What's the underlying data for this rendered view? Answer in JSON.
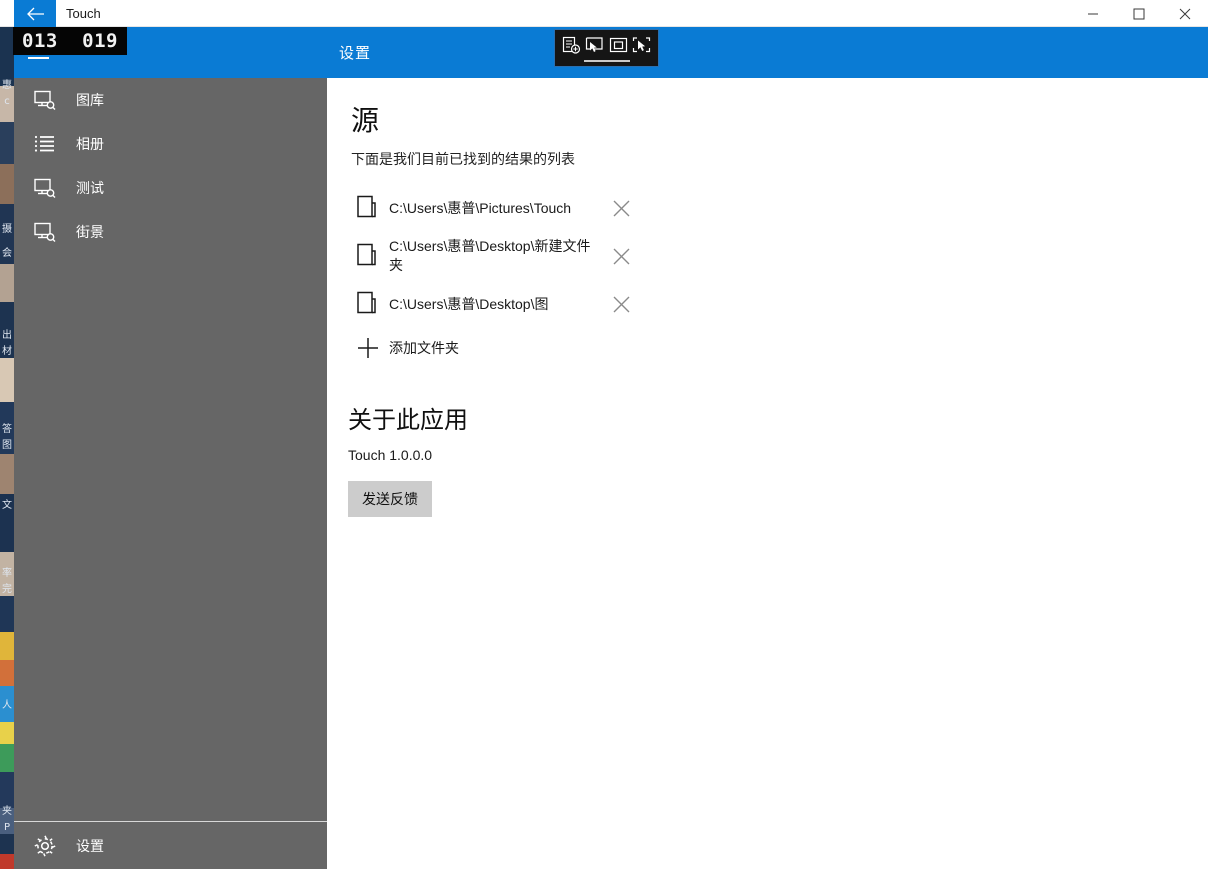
{
  "window": {
    "title": "Touch",
    "back_icon": "back-arrow-icon",
    "minimize_label": "—",
    "maximize_label": "□",
    "close_label": "✕"
  },
  "header": {
    "menu_icon": "hamburger-menu-icon",
    "title": "设置"
  },
  "coord_overlay": {
    "x_value": "013",
    "y_value": "019"
  },
  "capture_toolbar": {
    "icons": [
      "new-snip-icon",
      "rectangular-snip-icon",
      "window-snip-icon",
      "freeform-snip-icon"
    ]
  },
  "sidebar": {
    "items": [
      {
        "label": "图库",
        "icon": "photo-search-icon"
      },
      {
        "label": "相册",
        "icon": "list-icon"
      },
      {
        "label": "测试",
        "icon": "photo-search-icon"
      },
      {
        "label": "街景",
        "icon": "photo-search-icon"
      }
    ],
    "bottom_item": {
      "label": "设置",
      "icon": "gear-icon"
    }
  },
  "content": {
    "sources_title": "源",
    "sources_subtitle": "下面是我们目前已找到的结果的列表",
    "sources": [
      {
        "path": "C:\\Users\\惠普\\Pictures\\Touch",
        "icon": "folder-icon",
        "remove_icon": "close-icon"
      },
      {
        "path": "C:\\Users\\惠普\\Desktop\\新建文件夹",
        "icon": "folder-icon",
        "remove_icon": "close-icon"
      },
      {
        "path": "C:\\Users\\惠普\\Desktop\\图",
        "icon": "folder-icon",
        "remove_icon": "close-icon"
      }
    ],
    "add_folder": {
      "label": "添加文件夹",
      "icon": "plus-icon"
    },
    "about_title": "关于此应用",
    "version": "Touch 1.0.0.0",
    "feedback_label": "发送反馈"
  },
  "background_strip": {
    "fragments": [
      "惠",
      "c",
      "摄",
      "会",
      "出",
      "材",
      "答",
      "图",
      "文",
      "率",
      "完",
      "人",
      "夹",
      "P"
    ]
  },
  "colors": {
    "accent_blue": "#0a7bd4",
    "sidebar_gray": "#666666",
    "button_gray": "#cccccc",
    "overlay_black": "#050505"
  }
}
